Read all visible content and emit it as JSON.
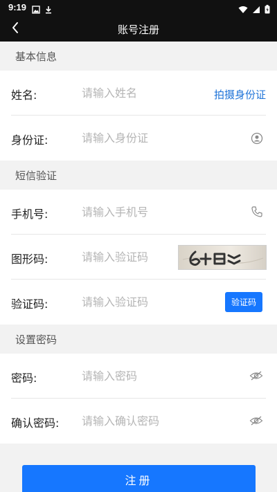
{
  "status_bar": {
    "time": "9:19",
    "left_icons": [
      "image-icon",
      "download-icon"
    ],
    "right_icons": [
      "wifi-icon",
      "signal-icon",
      "battery-icon"
    ]
  },
  "nav": {
    "title": "账号注册",
    "back_icon": "chevron-left-icon"
  },
  "sections": {
    "basic": {
      "title": "基本信息"
    },
    "sms": {
      "title": "短信验证"
    },
    "password": {
      "title": "设置密码"
    }
  },
  "fields": {
    "name": {
      "label": "姓名:",
      "placeholder": "请输入姓名",
      "value": "",
      "action_label": "拍摄身份证"
    },
    "id_card": {
      "label": "身份证:",
      "placeholder": "请输入身份证",
      "value": "",
      "icon": "person-circle-icon"
    },
    "phone": {
      "label": "手机号:",
      "placeholder": "请输入手机号",
      "value": "",
      "icon": "phone-icon"
    },
    "captcha": {
      "label": "图形码:",
      "placeholder": "请输入验证码",
      "value": ""
    },
    "sms_code": {
      "label": "验证码:",
      "placeholder": "请输入验证码",
      "value": "",
      "button_label": "验证码"
    },
    "password": {
      "label": "密码:",
      "placeholder": "请输入密码",
      "value": "",
      "icon": "eye-hidden-icon"
    },
    "confirm_password": {
      "label": "确认密码:",
      "placeholder": "请输入确认密码",
      "value": "",
      "icon": "eye-hidden-icon"
    }
  },
  "register_button": {
    "label": "注册"
  },
  "colors": {
    "primary": "#1677ff",
    "link": "#1e73d8",
    "bar": "#111111",
    "background": "#f2f2f2"
  }
}
